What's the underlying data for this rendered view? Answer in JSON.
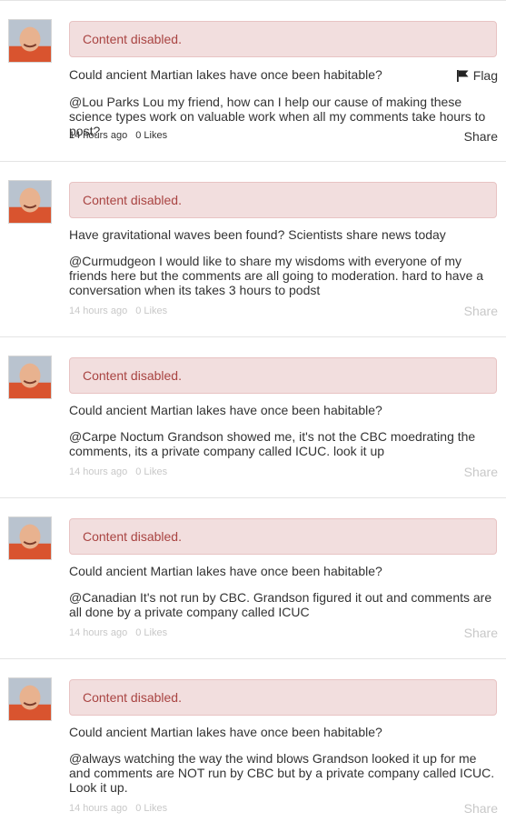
{
  "ui": {
    "flag_label": "Flag",
    "share_label": "Share",
    "disabled_notice": "Content disabled.",
    "likes_label": "0 Likes"
  },
  "comments": [
    {
      "article": "Could ancient Martian lakes have once been habitable?",
      "body": "@Lou Parks Lou my friend, how can I help our cause of making these science types work on valuable work when all my comments take hours to post?",
      "time": "14 hours ago",
      "likes": "0 Likes",
      "show_flag": true
    },
    {
      "article": "Have gravitational waves been found? Scientists share news today",
      "body": "@Curmudgeon I would like to share my wisdoms with everyone of my friends here but the comments are all going to moderation. hard to have a conversation when its takes 3 hours to podst",
      "time": "14 hours ago",
      "likes": "0 Likes",
      "show_flag": false
    },
    {
      "article": "Could ancient Martian lakes have once been habitable?",
      "body": "@Carpe Noctum Grandson showed me, it's not the CBC moedrating the comments, its a private company called ICUC. look it up",
      "time": "14 hours ago",
      "likes": "0 Likes",
      "show_flag": false
    },
    {
      "article": "Could ancient Martian lakes have once been habitable?",
      "body": "@Canadian It's not run by CBC. Grandson figured it out and comments are all done by a private company called ICUC",
      "time": "14 hours ago",
      "likes": "0 Likes",
      "show_flag": false
    },
    {
      "article": "Could ancient Martian lakes have once been habitable?",
      "body": "@always watching the way the wind blows Grandson looked it up for me and comments are NOT run by CBC but by a private company called ICUC. Look it up.",
      "time": "14 hours ago",
      "likes": "0 Likes",
      "show_flag": false
    }
  ]
}
